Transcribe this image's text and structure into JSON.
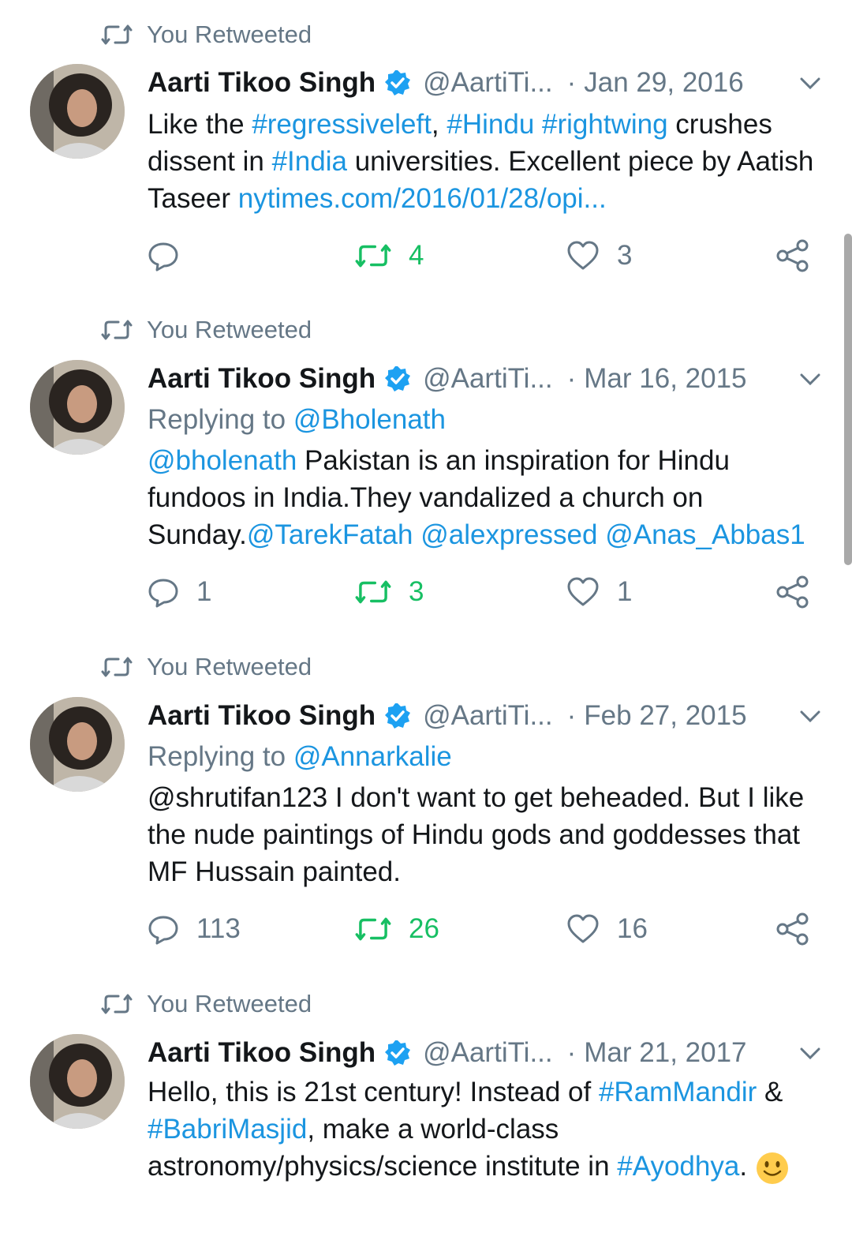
{
  "colors": {
    "link": "#1b95e0",
    "muted": "#657786",
    "retweet": "#17bf63",
    "text": "#14171a"
  },
  "tweets": [
    {
      "retweet_label": "You Retweeted",
      "name": "Aarti Tikoo Singh",
      "handle": "@AartiTi...",
      "sep": "·",
      "date": "Jan 29, 2016",
      "body": [
        {
          "t": "Like the "
        },
        {
          "t": "#regressiveleft",
          "link": true
        },
        {
          "t": ", "
        },
        {
          "t": "#Hindu",
          "link": true
        },
        {
          "t": " "
        },
        {
          "t": "#rightwing",
          "link": true
        },
        {
          "t": " crushes dissent in "
        },
        {
          "t": "#India",
          "link": true
        },
        {
          "t": " universities. Excellent piece by Aatish Taseer "
        },
        {
          "t": "nytimes.com/2016/01/28/opi...",
          "link": true
        }
      ],
      "reply_count": "",
      "retweet_count": "4",
      "like_count": "3"
    },
    {
      "retweet_label": "You Retweeted",
      "name": "Aarti Tikoo Singh",
      "handle": "@AartiTi...",
      "sep": "·",
      "date": "Mar 16, 2015",
      "replying_prefix": "Replying to ",
      "replying_to": "@Bholenath",
      "body": [
        {
          "t": "@bholenath",
          "link": true
        },
        {
          "t": " Pakistan is an inspiration for Hindu fundoos in India.They vandalized a church on Sunday."
        },
        {
          "t": "@TarekFatah",
          "link": true
        },
        {
          "t": " "
        },
        {
          "t": "@alexpressed",
          "link": true
        },
        {
          "t": " "
        },
        {
          "t": "@Anas_Abbas1",
          "link": true
        }
      ],
      "reply_count": "1",
      "retweet_count": "3",
      "like_count": "1"
    },
    {
      "retweet_label": "You Retweeted",
      "name": "Aarti Tikoo Singh",
      "handle": "@AartiTi...",
      "sep": "·",
      "date": "Feb 27, 2015",
      "replying_prefix": "Replying to ",
      "replying_to": "@Annarkalie",
      "body": [
        {
          "t": "@shrutifan123 I don't want to get beheaded. But I like the nude paintings of Hindu gods and goddesses that MF Hussain painted."
        }
      ],
      "reply_count": "113",
      "retweet_count": "26",
      "like_count": "16"
    },
    {
      "retweet_label": "You Retweeted",
      "name": "Aarti Tikoo Singh",
      "handle": "@AartiTi...",
      "sep": "·",
      "date": "Mar 21, 2017",
      "body": [
        {
          "t": "Hello, this is 21st century! Instead of "
        },
        {
          "t": "#RamMandir",
          "link": true
        },
        {
          "t": " & "
        },
        {
          "t": "#BabriMasjid",
          "link": true
        },
        {
          "t": ", make a world-class astronomy/physics/science institute in "
        },
        {
          "t": "#Ayodhya",
          "link": true
        },
        {
          "t": ". "
        },
        {
          "emoji": "smiling-face"
        }
      ],
      "reply_count": "",
      "retweet_count": "",
      "like_count": ""
    }
  ]
}
